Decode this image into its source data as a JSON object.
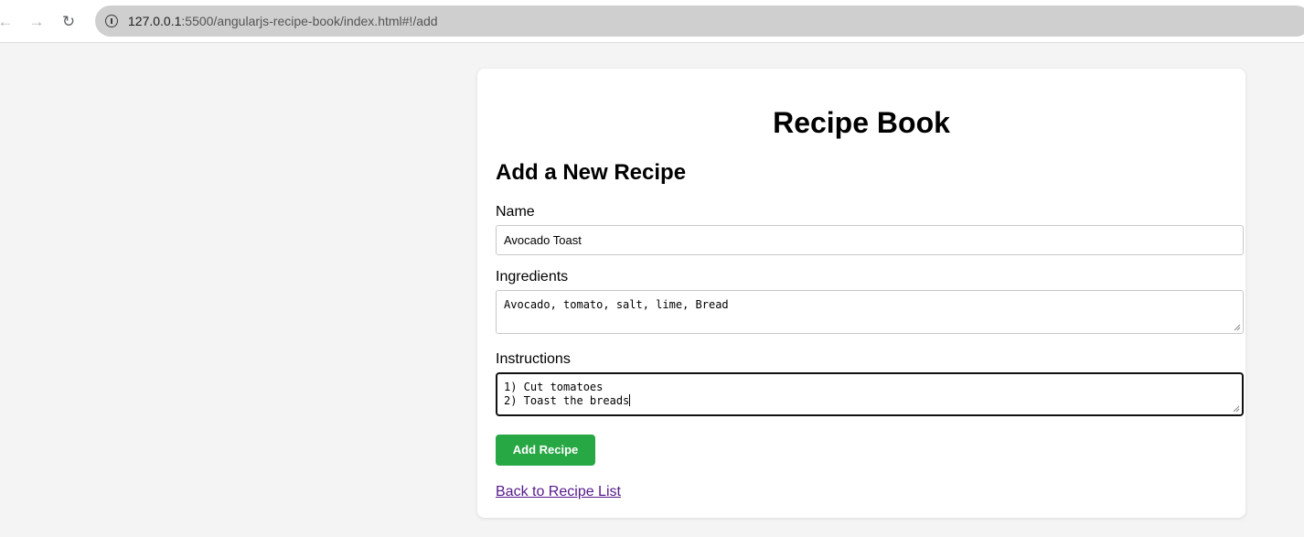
{
  "browser": {
    "back_icon": "arrow-left-icon",
    "forward_icon": "arrow-right-icon",
    "reload_icon": "reload-icon",
    "site_info_icon": "info-icon",
    "url_host": "127.0.0.1",
    "url_rest": ":5500/angularjs-recipe-book/index.html#!/add"
  },
  "app": {
    "title": "Recipe Book"
  },
  "form": {
    "heading": "Add a New Recipe",
    "name_label": "Name",
    "name_value": "Avocado Toast",
    "ingredients_label": "Ingredients",
    "ingredients_value": "Avocado, tomato, salt, lime, Bread",
    "instructions_label": "Instructions",
    "instructions_value": "1) Cut tomatoes\n2) Toast the breads",
    "submit_label": "Add Recipe",
    "back_link": "Back to Recipe List"
  },
  "colors": {
    "page_bg": "#f4f4f4",
    "card_bg": "#ffffff",
    "button_green": "#28a745",
    "visited_link": "#551a8b"
  }
}
